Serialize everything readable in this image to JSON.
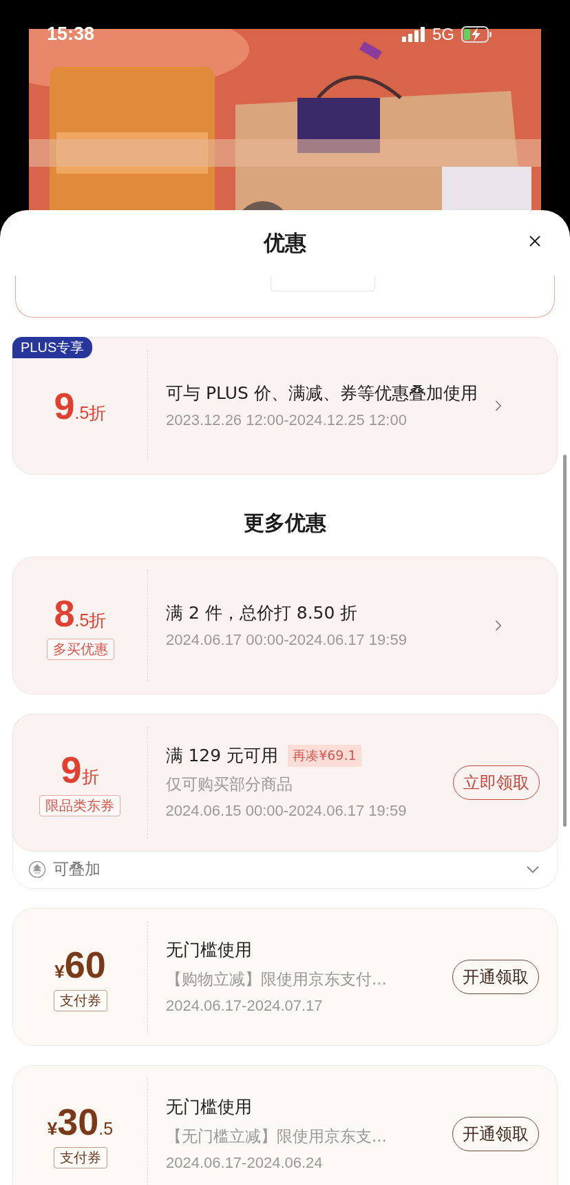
{
  "status_bar": {
    "time": "15:38",
    "network": "5G"
  },
  "sheet": {
    "title": "优惠"
  },
  "top_offers": [
    {
      "kind": "discount",
      "badge": "PLUS专享",
      "value_main": "9",
      "value_suffix": ".5折",
      "title": "可与 PLUS 价、满减、券等优惠叠加使用",
      "date": "2023.12.26 12:00-2024.12.25 12:00",
      "action": {
        "kind": "chevron"
      }
    }
  ],
  "more_title": "更多优惠",
  "more_offers": [
    {
      "kind": "discount",
      "value_main": "8",
      "value_suffix": ".5折",
      "tag": "多买优惠",
      "title": "满 2 件，总价打 8.50 折",
      "date": "2024.06.17 00:00-2024.06.17 19:59",
      "action": {
        "kind": "chevron"
      }
    },
    {
      "kind": "discount",
      "value_main": "9",
      "value_suffix": "折",
      "tag": "限品类东券",
      "title": "满 129 元可用",
      "hint": "再凑¥69.1",
      "subtitle": "仅可购买部分商品",
      "date": "2024.06.15 00:00-2024.06.17 19:59",
      "action": {
        "kind": "button",
        "label": "立即领取"
      },
      "footer": {
        "label": "可叠加",
        "expanded": false
      }
    },
    {
      "kind": "payment",
      "value_prefix": "¥",
      "value_main": "60",
      "tag": "支付券",
      "title": "无门槛使用",
      "subtitle": "【购物立减】限使用京东支付...",
      "date": "2024.06.17-2024.07.17",
      "action": {
        "kind": "button",
        "label": "开通领取"
      }
    },
    {
      "kind": "payment",
      "value_prefix": "¥",
      "value_main": "30",
      "value_suffix": ".5",
      "tag": "支付券",
      "title": "无门槛使用",
      "subtitle": "【无门槛立减】限使用京东支...",
      "date": "2024.06.17-2024.06.24",
      "action": {
        "kind": "button",
        "label": "开通领取"
      }
    }
  ]
}
